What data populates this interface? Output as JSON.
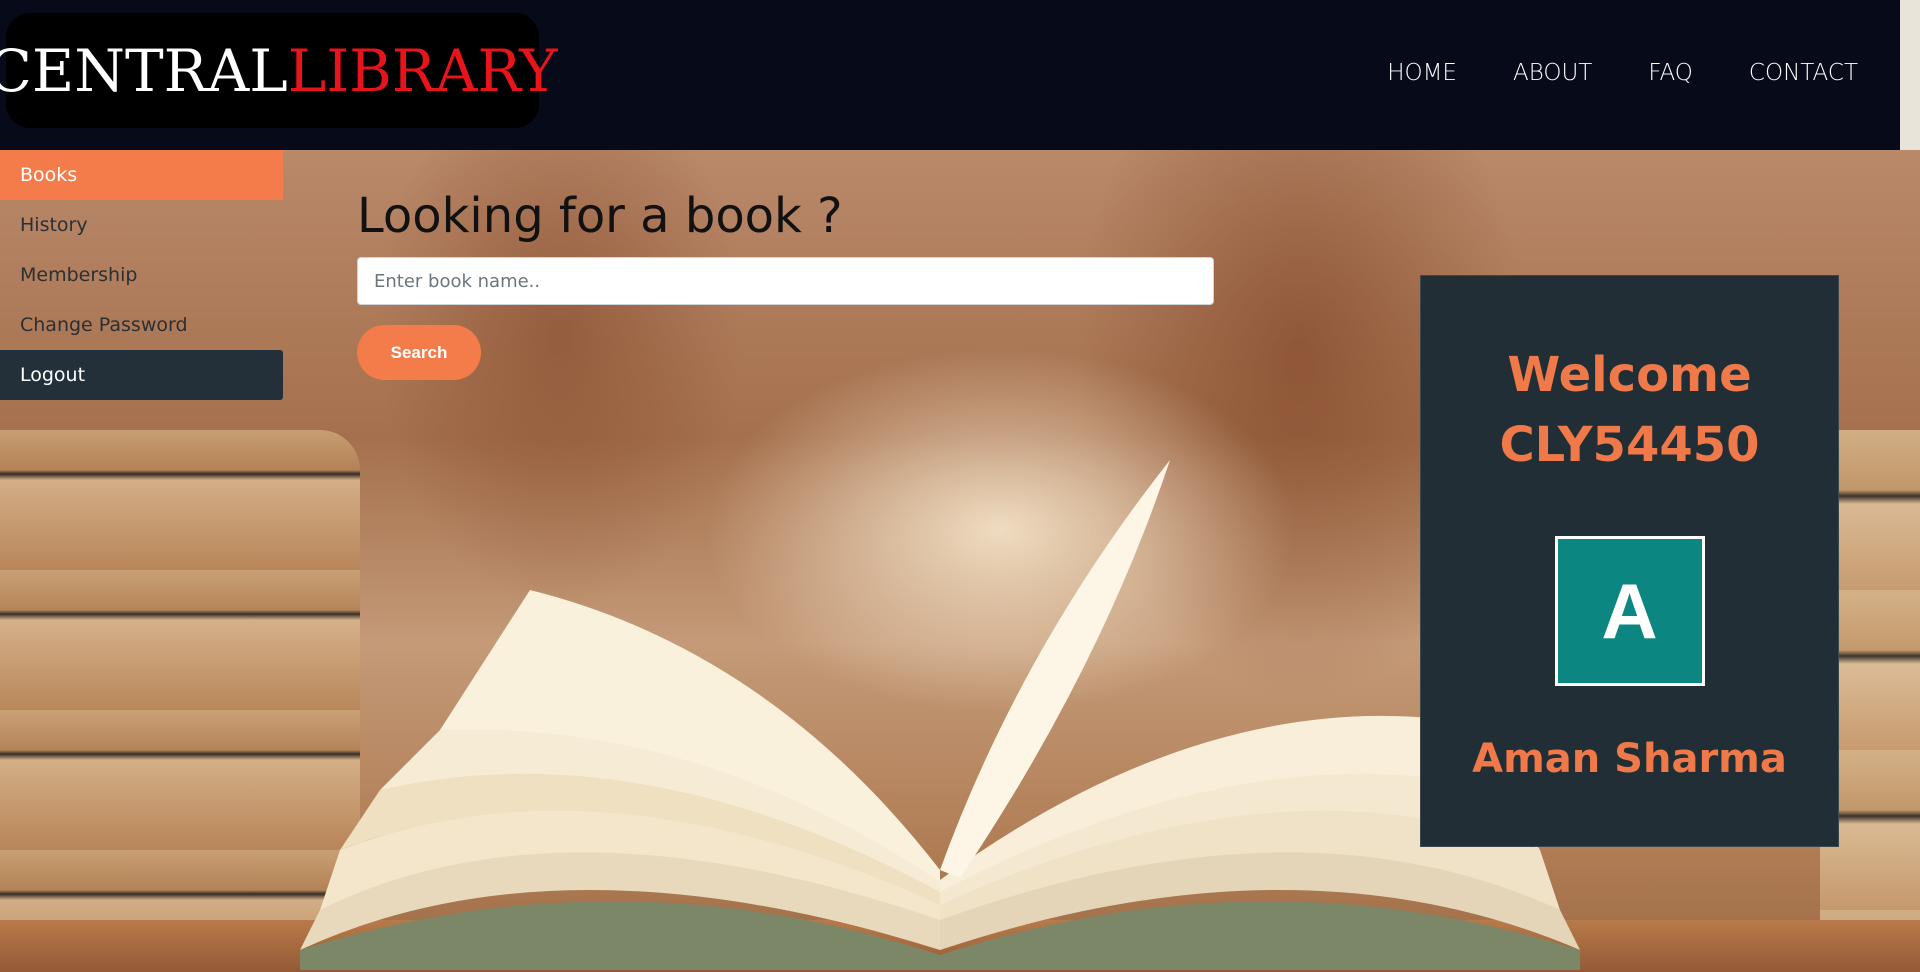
{
  "header": {
    "logo_part1": "CENTRAL",
    "logo_part2": "LIBRARY",
    "nav": [
      "HOME",
      "ABOUT",
      "FAQ",
      "CONTACT"
    ]
  },
  "sidebar": {
    "items": [
      {
        "label": "Books",
        "state": "active"
      },
      {
        "label": "History",
        "state": "normal"
      },
      {
        "label": "Membership",
        "state": "normal"
      },
      {
        "label": "Change Password",
        "state": "normal"
      },
      {
        "label": "Logout",
        "state": "dark"
      }
    ]
  },
  "search": {
    "title": "Looking for a book ?",
    "placeholder": "Enter book name..",
    "value": "",
    "button_label": "Search"
  },
  "profile": {
    "welcome_line1": "Welcome",
    "user_id": "CLY54450",
    "avatar_letter": "A",
    "name": "Aman Sharma"
  },
  "colors": {
    "accent": "#f47c4a",
    "navbar": "#070a18",
    "card": "#222e35",
    "avatar": "#0b8680",
    "logo_red": "#e8141b"
  }
}
